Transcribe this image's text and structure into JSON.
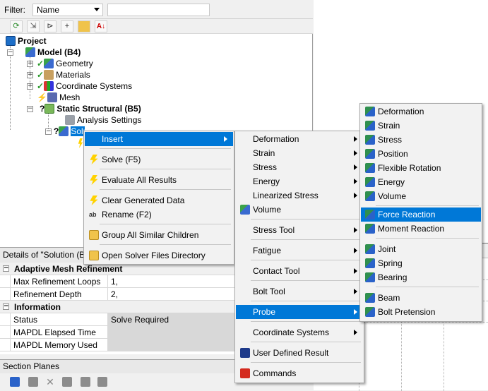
{
  "filter": {
    "label": "Filter:",
    "value": "Name"
  },
  "toolbar_icons": [
    "refresh-icon",
    "expand-icon",
    "connect-icon",
    "plus-icon",
    "folder-icon",
    "sort-az-icon"
  ],
  "tree": {
    "project": "Project",
    "model": "Model (B4)",
    "geometry": "Geometry",
    "materials": "Materials",
    "coordinate_systems": "Coordinate Systems",
    "mesh": "Mesh",
    "static_structural": "Static Structural (B5)",
    "analysis_settings": "Analysis Settings",
    "solution": "Solution (B6)"
  },
  "details": {
    "title": "Details of \"Solution (B",
    "sections": [
      {
        "name": "Adaptive Mesh Refinement",
        "rows": [
          {
            "key": "Max Refinement Loops",
            "value": "1,"
          },
          {
            "key": "Refinement Depth",
            "value": "2,"
          }
        ]
      },
      {
        "name": "Information",
        "rows": [
          {
            "key": "Status",
            "value": "Solve Required"
          },
          {
            "key": "MAPDL Elapsed Time",
            "value": ""
          },
          {
            "key": "MAPDL Memory Used",
            "value": ""
          }
        ]
      }
    ]
  },
  "section_planes": {
    "title": "Section Planes"
  },
  "context_menu": {
    "insert": "Insert",
    "solve": "Solve (F5)",
    "evaluate": "Evaluate All Results",
    "clear": "Clear Generated Data",
    "rename": "Rename (F2)",
    "group": "Group All Similar Children",
    "open_solver": "Open Solver Files Directory"
  },
  "insert_menu": {
    "deformation": "Deformation",
    "strain": "Strain",
    "stress": "Stress",
    "energy": "Energy",
    "linearized_stress": "Linearized Stress",
    "volume": "Volume",
    "stress_tool": "Stress Tool",
    "fatigue": "Fatigue",
    "contact_tool": "Contact Tool",
    "bolt_tool": "Bolt Tool",
    "probe": "Probe",
    "coordinate_systems": "Coordinate Systems",
    "user_defined_result": "User Defined Result",
    "commands": "Commands"
  },
  "probe_menu": {
    "deformation": "Deformation",
    "strain": "Strain",
    "stress": "Stress",
    "position": "Position",
    "flexible_rotation": "Flexible Rotation",
    "energy": "Energy",
    "volume": "Volume",
    "force_reaction": "Force Reaction",
    "moment_reaction": "Moment Reaction",
    "joint": "Joint",
    "spring": "Spring",
    "bearing": "Bearing",
    "beam": "Beam",
    "bolt_pretension": "Bolt Pretension"
  },
  "colors": {
    "highlight": "#0078d7",
    "menu_bg": "#f2f2f2"
  }
}
